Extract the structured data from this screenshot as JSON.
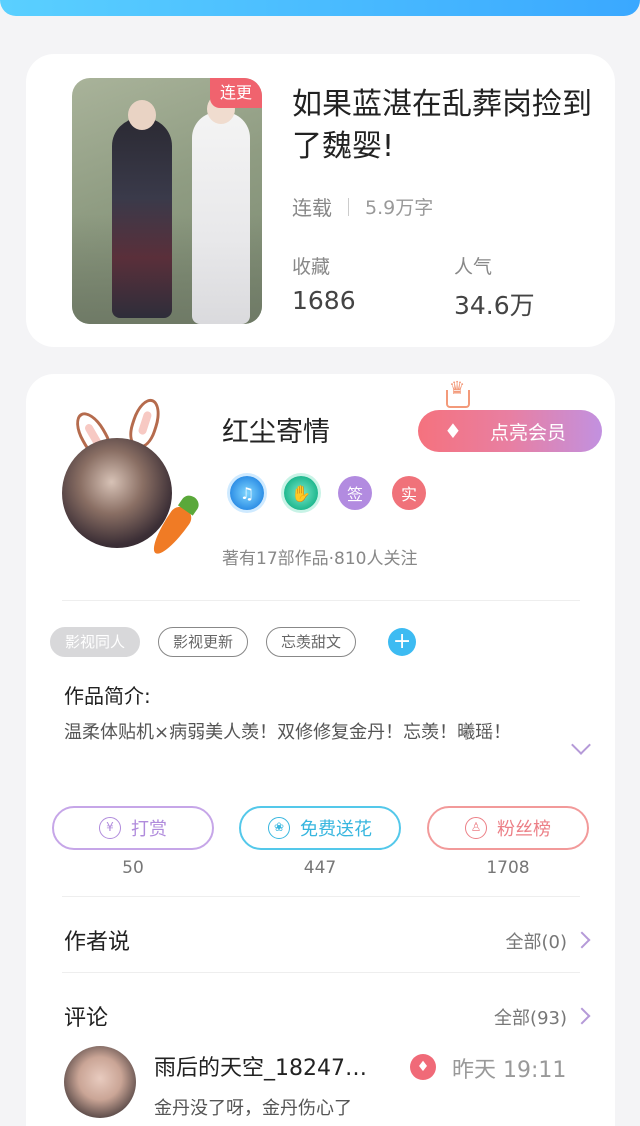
{
  "book": {
    "tag": "连更",
    "title": "如果蓝湛在乱葬岗捡到了魏婴!",
    "status": "连载",
    "word_count": "5.9万字",
    "stats": [
      {
        "label": "收藏",
        "value": "1686"
      },
      {
        "label": "人气",
        "value": "34.6万"
      }
    ]
  },
  "author": {
    "name": "红尘寄情",
    "vip_button": "点亮会员",
    "badges": [
      {
        "name": "music-badge",
        "text": "♫",
        "color": "#2e8fe6"
      },
      {
        "name": "handshake-badge",
        "text": "✋",
        "color": "#1fb88f"
      },
      {
        "name": "signed-badge",
        "text": "签",
        "color": "#b28be0"
      },
      {
        "name": "verified-badge",
        "text": "实",
        "color": "#f0727a"
      }
    ],
    "meta": "著有17部作品·810人关注"
  },
  "tags": [
    "影视同人",
    "影视更新",
    "忘羡甜文"
  ],
  "intro": {
    "title": "作品简介:",
    "text": "温柔体贴机×病弱美人羡！双修修复金丹！忘羡！曦瑶！"
  },
  "actions": [
    {
      "label": "打赏",
      "icon": "¥",
      "count": "50"
    },
    {
      "label": "免费送花",
      "icon": "❀",
      "count": "447"
    },
    {
      "label": "粉丝榜",
      "icon": "♙",
      "count": "1708"
    }
  ],
  "author_says": {
    "title": "作者说",
    "more": "全部(0)"
  },
  "comments": {
    "title": "评论",
    "more": "全部(93)",
    "first": {
      "user": "雨后的天空_18247…",
      "time": "昨天 19:11",
      "text": "金丹没了呀，金丹伤心了"
    }
  },
  "colors": {
    "accent_blue": "#3aa8ff",
    "vip_gradient_start": "#f5727e",
    "vip_gradient_end": "#c291e0"
  }
}
